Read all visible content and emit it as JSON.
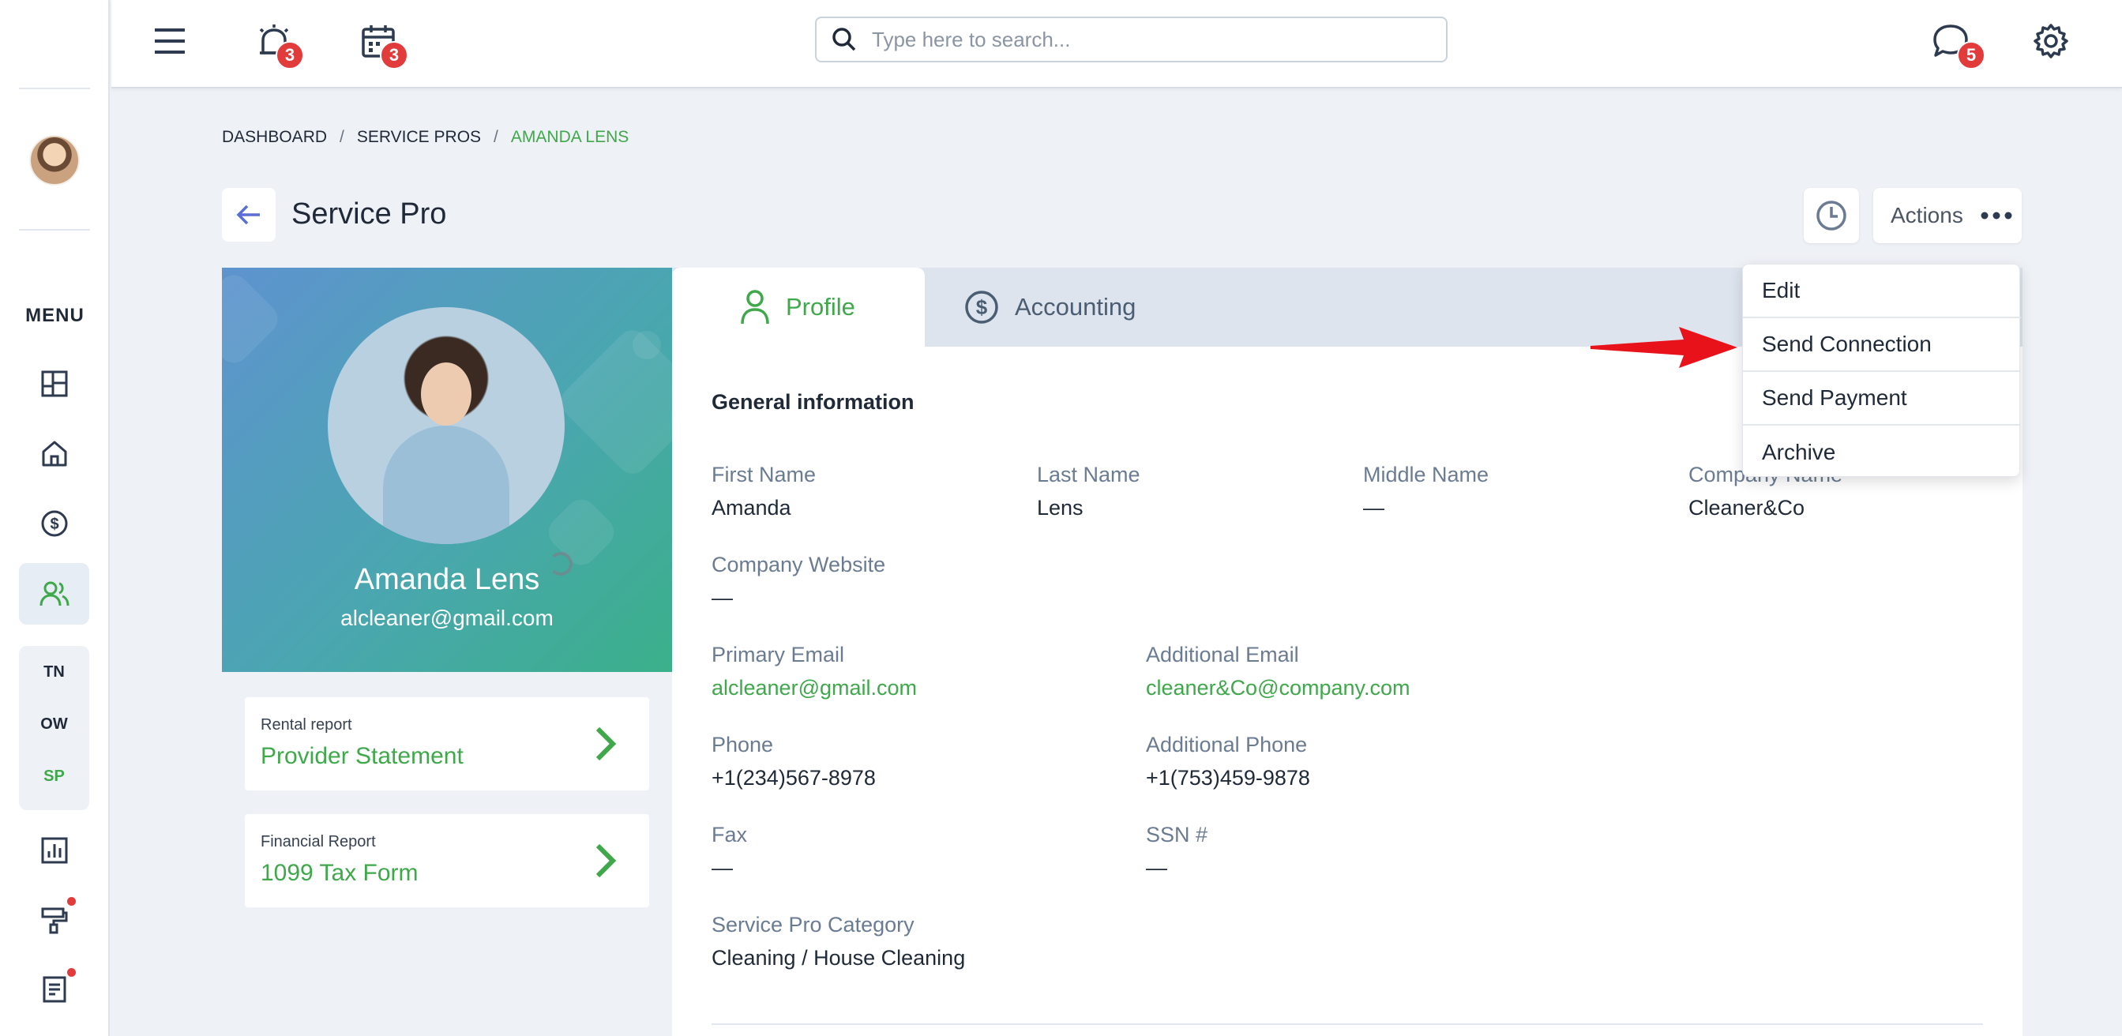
{
  "search": {
    "placeholder": "Type here to search..."
  },
  "topbar": {
    "alerts_badge": "3",
    "calendar_badge": "3",
    "messages_badge": "5"
  },
  "sidebar": {
    "menu_label": "MENU",
    "group_items": [
      "TN",
      "OW",
      "SP"
    ]
  },
  "breadcrumb": [
    "DASHBOARD",
    "SERVICE PROS",
    "AMANDA LENS"
  ],
  "page": {
    "title": "Service Pro",
    "actions_label": "Actions"
  },
  "profile": {
    "name": "Amanda Lens",
    "email": "alcleaner@gmail.com"
  },
  "reports": [
    {
      "label": "Rental report",
      "value": "Provider Statement"
    },
    {
      "label": "Financial Report",
      "value": "1099 Tax Form"
    }
  ],
  "tabs": {
    "profile": "Profile",
    "accounting": "Accounting"
  },
  "general": {
    "title": "General information",
    "first_name_label": "First Name",
    "first_name": "Amanda",
    "last_name_label": "Last Name",
    "last_name": "Lens",
    "middle_name_label": "Middle Name",
    "middle_name": "—",
    "company_name_label": "Company Name",
    "company_name": "Cleaner&Co",
    "website_label": "Company Website",
    "website": "—",
    "primary_email_label": "Primary Email",
    "primary_email": "alcleaner@gmail.com",
    "additional_email_label": "Additional Email",
    "additional_email": "cleaner&Co@company.com",
    "phone_label": "Phone",
    "phone": "+1(234)567-8978",
    "additional_phone_label": "Additional Phone",
    "additional_phone": "+1(753)459-9878",
    "fax_label": "Fax",
    "fax": "—",
    "ssn_label": "SSN #",
    "ssn": "—",
    "category_label": "Service Pro Category",
    "category": "Cleaning / House Cleaning"
  },
  "actions_menu": [
    "Edit",
    "Send Connection",
    "Send Payment",
    "Archive"
  ],
  "colors": {
    "accent": "#3ea84a",
    "badge": "#e23b3b",
    "arrow": "#e8121b"
  }
}
